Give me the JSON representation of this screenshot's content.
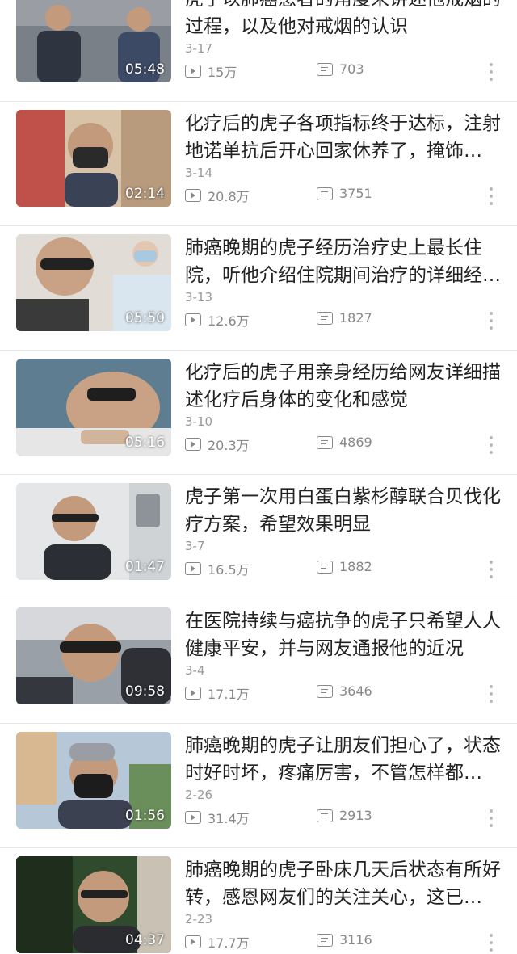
{
  "videos": [
    {
      "title": "虎子以肺癌患者的角度来讲述他戒烟的过程，以及他对戒烟的认识",
      "date": "3-17",
      "views": "15万",
      "comments": "703",
      "duration": "05:48",
      "thumb_bg": "#7a8088"
    },
    {
      "title": "化疗后的虎子各项指标终于达标，注射地诺单抗后开心回家休养了，掩饰…",
      "date": "3-14",
      "views": "20.8万",
      "comments": "3751",
      "duration": "02:14",
      "thumb_bg": "#c8a68a"
    },
    {
      "title": "肺癌晚期的虎子经历治疗史上最长住院，听他介绍住院期间治疗的详细经…",
      "date": "3-13",
      "views": "12.6万",
      "comments": "1827",
      "duration": "05:50",
      "thumb_bg": "#b9a89e"
    },
    {
      "title": "化疗后的虎子用亲身经历给网友详细描述化疗后身体的变化和感觉",
      "date": "3-10",
      "views": "20.3万",
      "comments": "4869",
      "duration": "05:16",
      "thumb_bg": "#6d8a9c"
    },
    {
      "title": "虎子第一次用白蛋白紫杉醇联合贝伐化疗方案，希望效果明显",
      "date": "3-7",
      "views": "16.5万",
      "comments": "1882",
      "duration": "01:47",
      "thumb_bg": "#d9dce0"
    },
    {
      "title": "在医院持续与癌抗争的虎子只希望人人健康平安，并与网友通报他的近况",
      "date": "3-4",
      "views": "17.1万",
      "comments": "3646",
      "duration": "09:58",
      "thumb_bg": "#8c8f96"
    },
    {
      "title": "肺癌晚期的虎子让朋友们担心了，状态时好时坏，疼痛厉害，不管怎样都…",
      "date": "2-26",
      "views": "31.4万",
      "comments": "2913",
      "duration": "01:56",
      "thumb_bg": "#b6c8d8"
    },
    {
      "title": "肺癌晚期的虎子卧床几天后状态有所好转，感恩网友们的关注关心，这已…",
      "date": "2-23",
      "views": "17.7万",
      "comments": "3116",
      "duration": "04:37",
      "thumb_bg": "#3f5a3a"
    }
  ]
}
